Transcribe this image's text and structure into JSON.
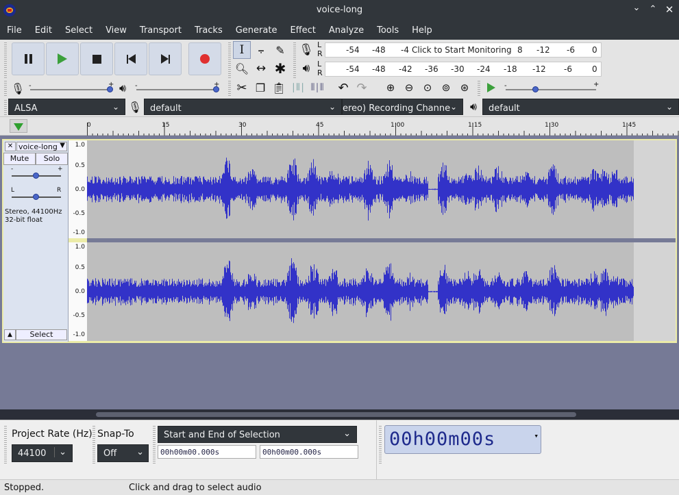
{
  "window": {
    "title": "voice-long"
  },
  "menu": [
    "File",
    "Edit",
    "Select",
    "View",
    "Transport",
    "Tracks",
    "Generate",
    "Effect",
    "Analyze",
    "Tools",
    "Help"
  ],
  "meters": {
    "record_scale": [
      "-54",
      "-48",
      "-4",
      "8",
      "-12",
      "-6",
      "0"
    ],
    "record_hint": "Click to Start Monitoring",
    "play_scale": [
      "-54",
      "-48",
      "-42",
      "-36",
      "-30",
      "-24",
      "-18",
      "-12",
      "-6",
      "0"
    ],
    "lr": [
      "L",
      "R"
    ]
  },
  "device": {
    "host": "ALSA",
    "recording_device": "default",
    "channels": "ereo) Recording Channels",
    "playback_device": "default"
  },
  "ruler": {
    "ticks": [
      "0",
      "15",
      "30",
      "45",
      "1:00",
      "1:15",
      "1:30",
      "1:45"
    ]
  },
  "track": {
    "name": "voice-long",
    "mute_label": "Mute",
    "solo_label": "Solo",
    "gain_minus": "-",
    "gain_plus": "+",
    "pan_left": "L",
    "pan_right": "R",
    "info_line1": "Stereo, 44100Hz",
    "info_line2": "32-bit float",
    "select_label": "Select",
    "scale": [
      "1.0",
      "0.5",
      "0.0",
      "-0.5",
      "-1.0"
    ]
  },
  "bottom": {
    "project_rate_label": "Project Rate (Hz)",
    "project_rate_value": "44100",
    "snap_label": "Snap-To",
    "snap_value": "Off",
    "selection_mode": "Start and End of Selection",
    "sel_start": "00h00m00.000s",
    "sel_end": "00h00m00.000s",
    "audio_position": "00h00m00s"
  },
  "status": {
    "state": "Stopped.",
    "hint": "Click and drag to select audio"
  },
  "colors": {
    "waveform": "#3232c8",
    "selection_border": "#ececa8",
    "dark_chrome": "#31363b"
  }
}
